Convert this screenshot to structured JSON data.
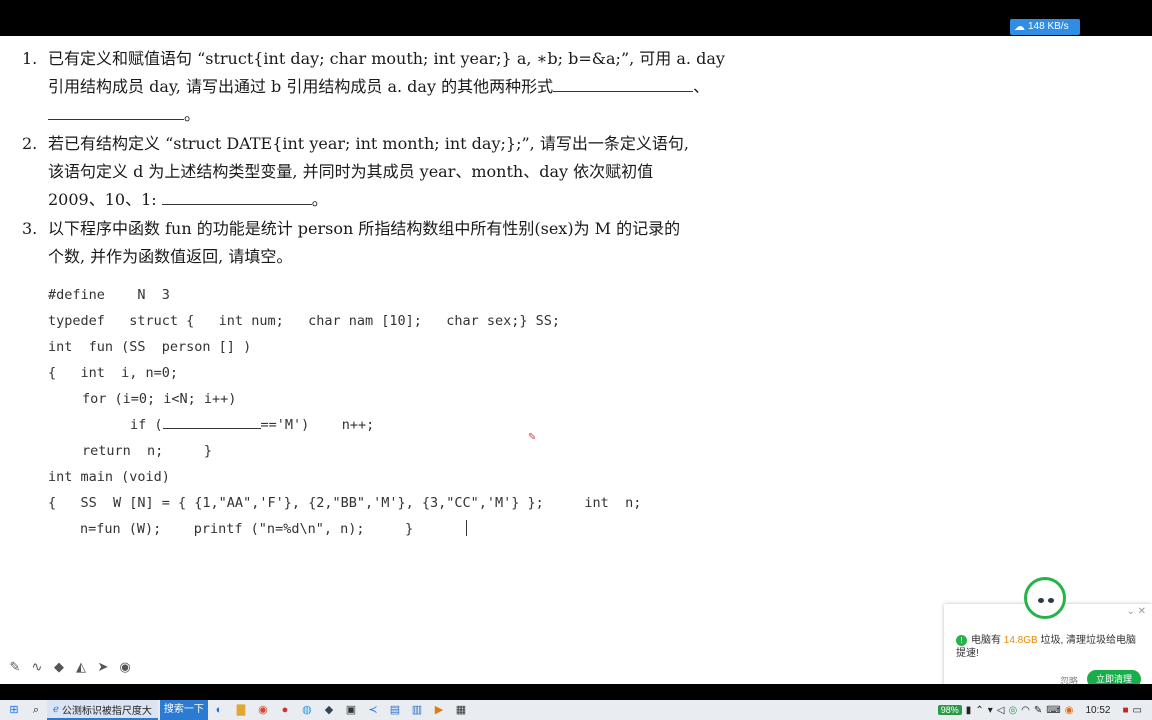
{
  "network_speed": "148 KB/s",
  "questions": [
    {
      "num": "1.",
      "line1": "已有定义和赋值语句 “struct{int day; char mouth; int year;} a, ∗b; b=&a;”, 可用 a. day",
      "line2": "引用结构成员 day, 请写出通过 b 引用结构成员 a. day 的其他两种形式",
      "line2_suffix": "、",
      "line3_suffix": "。"
    },
    {
      "num": "2.",
      "line1": "若已有结构定义 “struct DATE{int year; int month; int day;};”, 请写出一条定义语句,",
      "line2": "该语句定义 d 为上述结构类型变量, 并同时为其成员 year、month、day 依次赋初值",
      "line3": "2009、10、1:",
      "line3_suffix": "。"
    },
    {
      "num": "3.",
      "line1": "以下程序中函数 fun 的功能是统计 person 所指结构数组中所有性别(sex)为 M 的记录的",
      "line2": "个数, 并作为函数值返回, 请填空。"
    }
  ],
  "code": {
    "define": "#define    N  3",
    "typedef": "typedef   struct {   int num;   char nam [10];   char sex;} SS;",
    "fun_sig": "int  fun (SS  person [] )",
    "fun_open": "{   int  i, n=0;",
    "for_line": "for (i=0; i<N; i++)",
    "if_prefix": "if (",
    "if_suffix": "=='M')    n++;",
    "return_line": "return  n;     }",
    "main_sig": "int main (void)",
    "main_body": "{   SS  W [N] = { {1,\"AA\",'F'}, {2,\"BB\",'M'}, {3,\"CC\",'M'} };     int  n;",
    "call_line": "n=fun (W);    printf (\"n=%d\\n\", n);     }"
  },
  "popup": {
    "msg_prefix": "电脑有",
    "msg_amount": "14.8GB",
    "msg_suffix": "垃圾, 清理垃圾给电脑提速!",
    "ignore": "忽略",
    "clean": "立即清理"
  },
  "taskbar": {
    "ie_title": "公测标识被指尺度大",
    "search_button": "搜索一下",
    "battery": "98%",
    "time": "10:52"
  }
}
